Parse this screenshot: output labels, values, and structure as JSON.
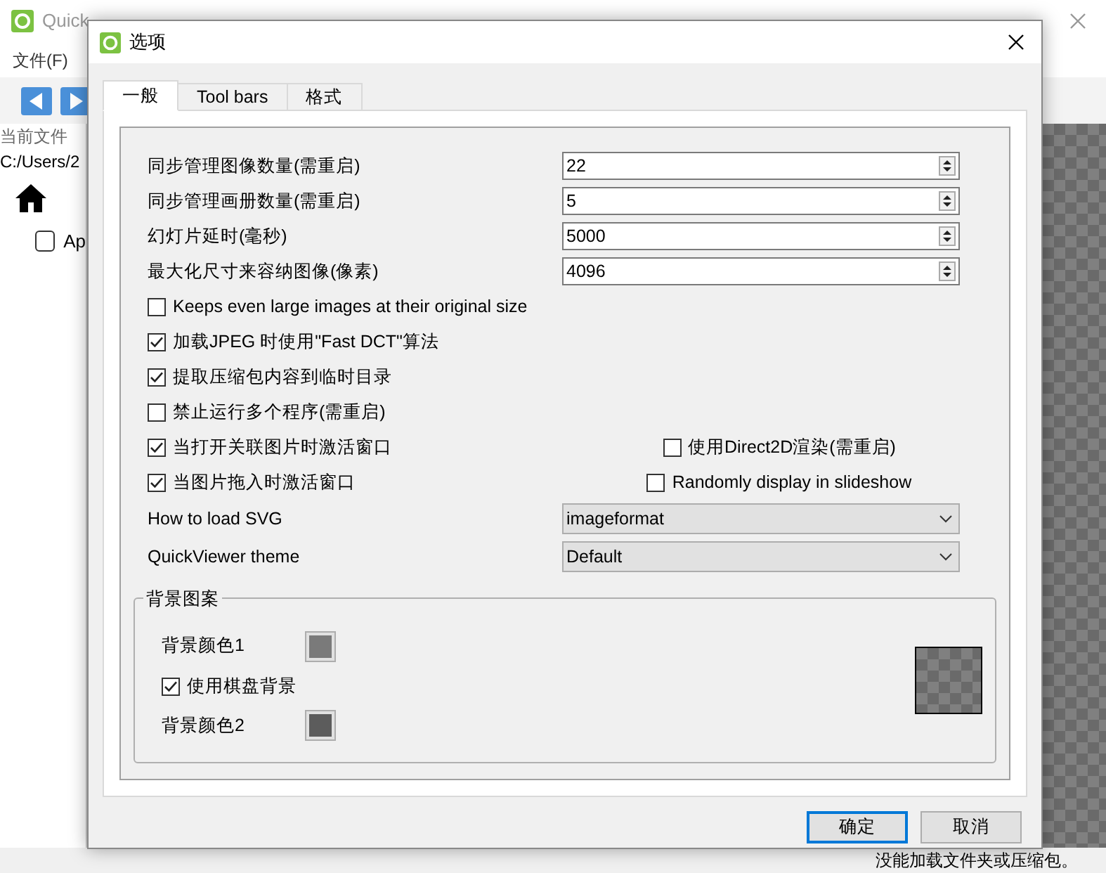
{
  "app": {
    "title": "Quick",
    "menu": [
      "文件(F)"
    ],
    "folder_label": "当前文件",
    "path": "C:/Users/2",
    "tree_item": {
      "label": "Ap",
      "checked": false
    },
    "status": "没能加载文件夹或压缩包。"
  },
  "dialog": {
    "title": "选项",
    "tabs": [
      {
        "label": "一般",
        "selected": true
      },
      {
        "label": "Tool bars",
        "selected": false
      },
      {
        "label": "格式",
        "selected": false
      }
    ],
    "rows": [
      [
        {
          "kind": "text",
          "label": "同步管理图像数量(需重启)"
        },
        {
          "kind": "spin",
          "value": "22"
        }
      ],
      [
        {
          "kind": "text",
          "label": "同步管理画册数量(需重启)"
        },
        {
          "kind": "spin",
          "value": "5"
        }
      ],
      [
        {
          "kind": "text",
          "label": "幻灯片延时(毫秒)"
        },
        {
          "kind": "spin",
          "value": "5000"
        }
      ],
      [
        {
          "kind": "text",
          "label": "最大化尺寸来容纳图像(像素)"
        },
        {
          "kind": "spin",
          "value": "4096"
        }
      ],
      [
        {
          "kind": "checkbox",
          "label": "Keeps even large images at their original size",
          "checked": false
        }
      ],
      [
        {
          "kind": "checkbox",
          "label": "加载JPEG 时使用\"Fast DCT\"算法",
          "checked": true
        }
      ],
      [
        {
          "kind": "checkbox",
          "label": "提取压缩包内容到临时目录",
          "checked": true
        }
      ],
      [
        {
          "kind": "checkbox",
          "label": "禁止运行多个程序(需重启)",
          "checked": false
        }
      ],
      [
        {
          "kind": "checkbox",
          "label": "当打开关联图片时激活窗口",
          "checked": true
        },
        {
          "kind": "checkbox",
          "label": "使用Direct2D渲染(需重启)",
          "checked": false
        }
      ],
      [
        {
          "kind": "checkbox",
          "label": "当图片拖入时激活窗口",
          "checked": true
        },
        {
          "kind": "checkbox",
          "label": "Randomly display in slideshow",
          "checked": false
        }
      ],
      [
        {
          "kind": "text",
          "label": "How to load SVG"
        },
        {
          "kind": "combo",
          "value": "imageformat"
        }
      ],
      [
        {
          "kind": "text",
          "label": "QuickViewer theme"
        },
        {
          "kind": "combo",
          "value": "Default"
        }
      ]
    ],
    "background_group": {
      "title": "背景图案",
      "items": [
        {
          "kind": "color",
          "label": "背景颜色1",
          "color": "#7a7a7a"
        },
        {
          "kind": "checkbox",
          "label": "使用棋盘背景",
          "checked": true
        },
        {
          "kind": "color",
          "label": "背景颜色2",
          "color": "#5c5c5c"
        }
      ]
    },
    "buttons": [
      {
        "label": "确定",
        "default": true
      },
      {
        "label": "取消",
        "default": false
      }
    ]
  }
}
